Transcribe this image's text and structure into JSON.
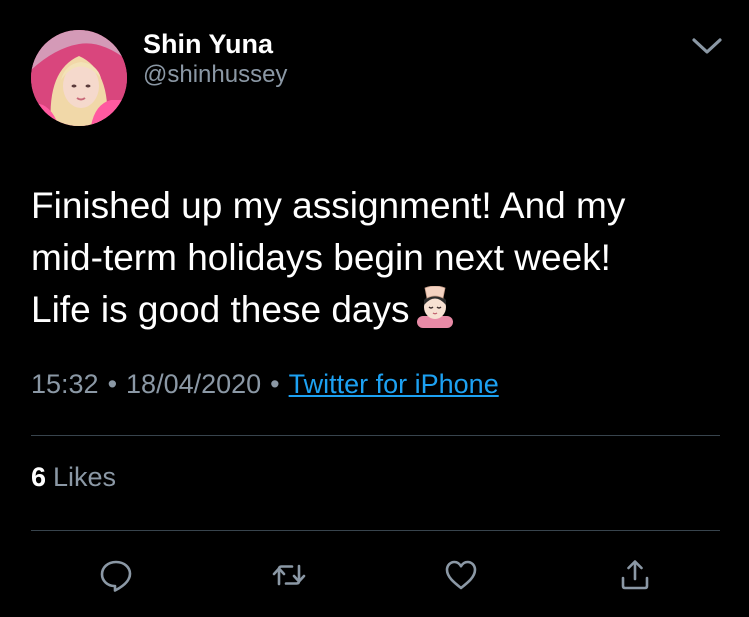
{
  "user": {
    "display_name": "Shin Yuna",
    "handle": "@shinhussey",
    "avatar": "profile-photo"
  },
  "tweet": {
    "lines": [
      "Finished up my assignment! And my",
      "mid-term holidays begin next week!",
      "Life is good these days"
    ],
    "emoji": "person-getting-massage-emoji"
  },
  "meta": {
    "time": "15:32",
    "date": "18/04/2020",
    "separator": "•",
    "source": "Twitter for iPhone"
  },
  "stats": {
    "likes_count": "6",
    "likes_label": "Likes"
  },
  "actions": [
    "reply-icon",
    "retweet-icon",
    "like-icon",
    "share-icon"
  ],
  "colors": {
    "background": "#000000",
    "text": "#ffffff",
    "secondary": "#8b98a5",
    "link": "#1da1f2",
    "divider": "#38444d"
  }
}
